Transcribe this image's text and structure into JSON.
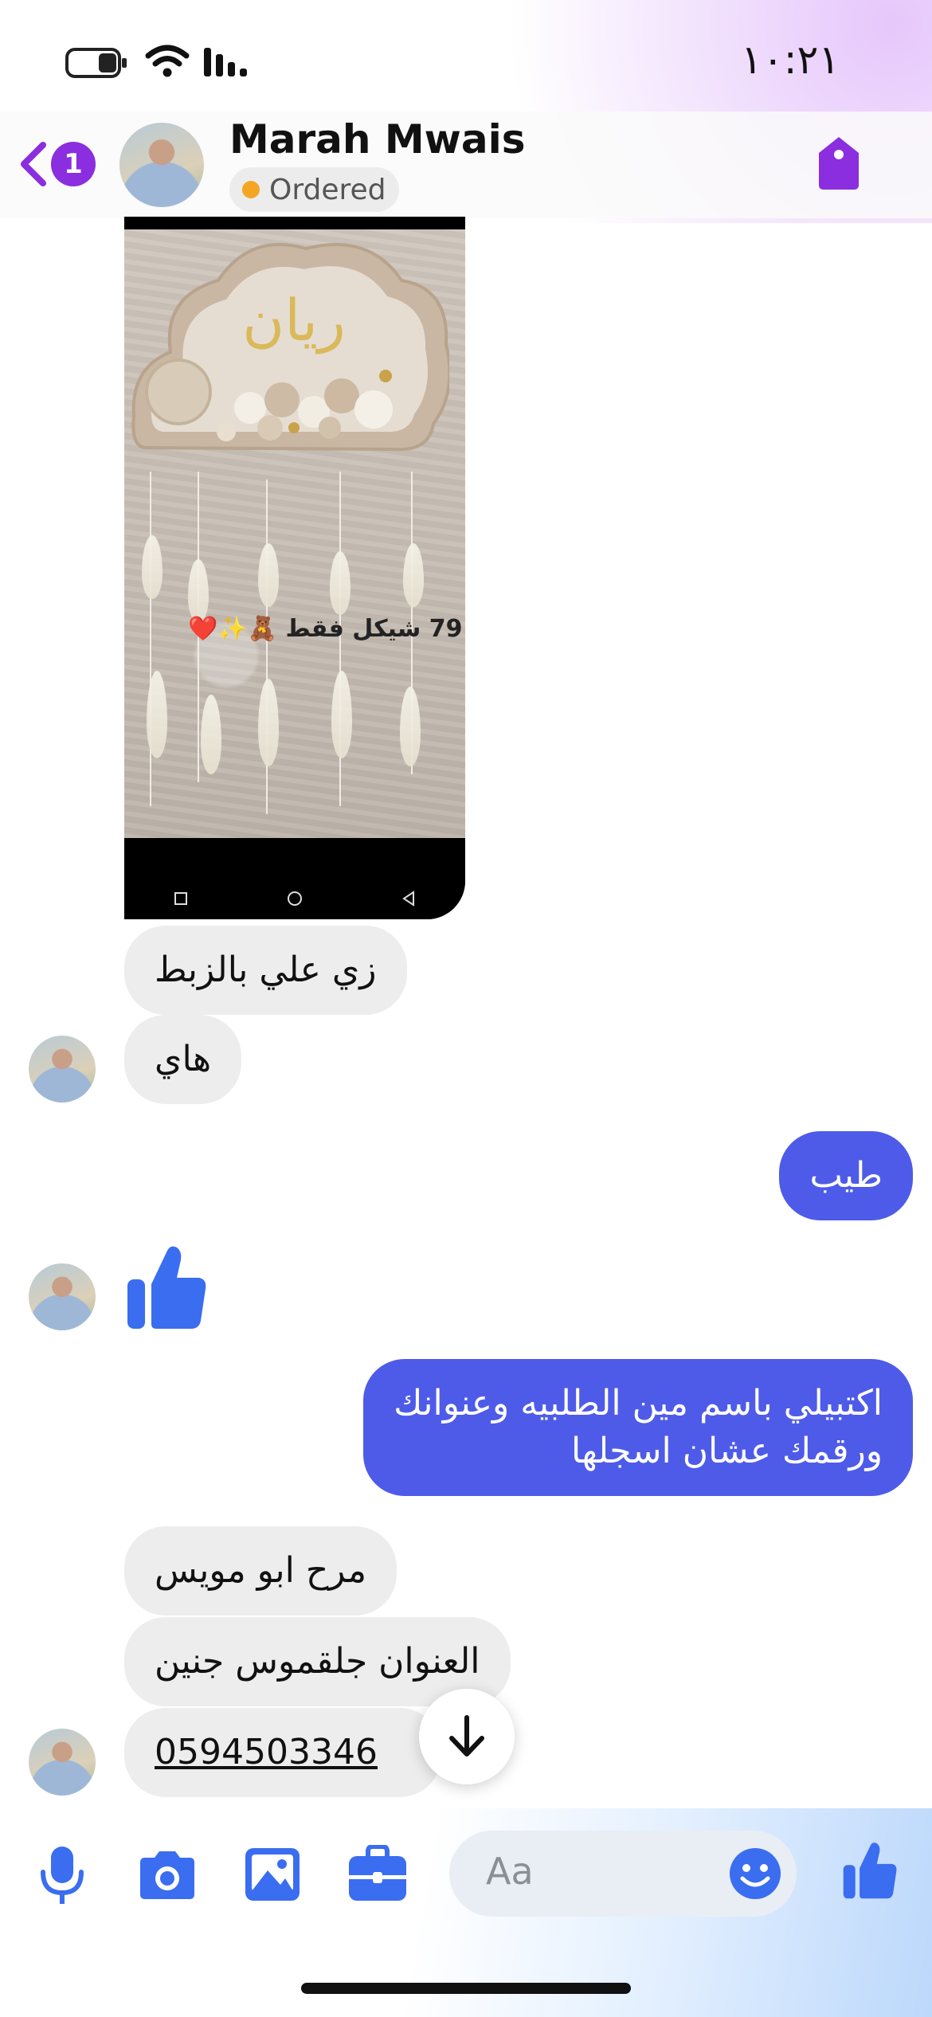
{
  "status_bar": {
    "time": "١٠:٢١",
    "icons": [
      "battery-icon",
      "wifi-icon",
      "signal-icon"
    ]
  },
  "header": {
    "back_icon": "chevron-left-icon",
    "unread_count": "1",
    "contact_name": "Marah Mwais",
    "status_label": "Ordered",
    "status_color": "#f4a623",
    "label_icon": "tag-icon",
    "accent": "#8a2ee0"
  },
  "photo": {
    "decor_text": "ريان",
    "caption": "79 شيكل فقط 🧸✨❤️"
  },
  "messages": [
    {
      "from": "them",
      "text": "زي علي بالزبط"
    },
    {
      "from": "them",
      "text": "هاي"
    },
    {
      "from": "me",
      "text": "طيب"
    },
    {
      "from": "them",
      "type": "like",
      "icon": "thumbs-up-icon"
    },
    {
      "from": "me",
      "lines": [
        "اكتبيلي باسم مين الطلبيه وعنوانك",
        "ورقمك عشان اسجلها"
      ]
    },
    {
      "from": "them",
      "text": "مرح ابو مويس"
    },
    {
      "from": "them",
      "text": "العنوان جلقموس جنين"
    },
    {
      "from": "them",
      "text": "0594503346"
    }
  ],
  "composer": {
    "placeholder": "Aa",
    "tools": [
      "microphone-icon",
      "camera-icon",
      "image-icon",
      "briefcase-icon"
    ],
    "emoji_icon": "smiley-icon",
    "send_icon": "thumbs-up-icon",
    "accent": "#3a6df0"
  }
}
